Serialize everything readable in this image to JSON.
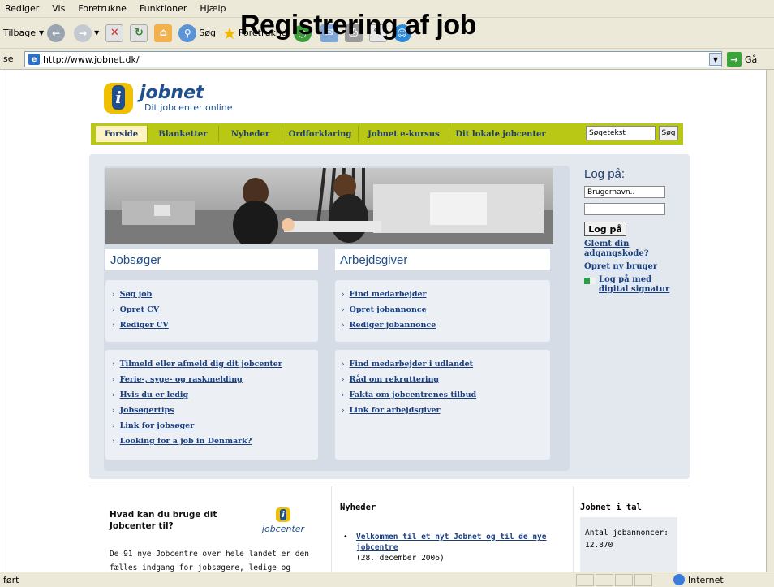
{
  "overlay_title": "Registrering af job",
  "browser": {
    "menu": [
      "Rediger",
      "Vis",
      "Foretrukne",
      "Funktioner",
      "Hjælp"
    ],
    "toolbar": {
      "back": "Tilbage",
      "search": "Søg",
      "favorites": "Foretrukne"
    },
    "address_label": "se",
    "url": "http://www.jobnet.dk/",
    "go": "Gå",
    "status": "ført",
    "zone": "Internet"
  },
  "site": {
    "logo_name": "jobnet",
    "logo_tagline": "Dit jobcenter online",
    "nav": [
      "Forside",
      "Blanketter",
      "Nyheder",
      "Ordforklaring",
      "Jobnet e-kursus",
      "Dit lokale jobcenter"
    ],
    "search_placeholder": "Søgetekst",
    "search_button": "Søg",
    "login": {
      "title": "Log på:",
      "username_placeholder": "Brugernavn..",
      "button": "Log på",
      "forgot": "Glemt din adgangskode?",
      "create": "Opret ny bruger",
      "digital": "Log på med digital signatur"
    },
    "jobseeker": {
      "title": "Jobsøger",
      "links_top": [
        "Søg job",
        "Opret CV",
        "Rediger CV"
      ],
      "links_bottom": [
        "Tilmeld eller afmeld dig dit jobcenter",
        "Ferie-, syge- og raskmelding",
        "Hvis du er ledig",
        "Jobsøgertips",
        "Link for jobsøger",
        "Looking for a job in Denmark?"
      ]
    },
    "employer": {
      "title": "Arbejdsgiver",
      "links_top": [
        "Find medarbejder",
        "Opret jobannonce",
        "Rediger jobannonce"
      ],
      "links_bottom": [
        "Find medarbejder i udlandet",
        "Råd om rekruttering",
        "Fakta om jobcentrenes tilbud",
        "Link for arbejdsgiver"
      ]
    },
    "bottom": {
      "col1_title": "Hvad kan du bruge dit Jobcenter til?",
      "col1_text": "De 91 nye Jobcentre over hele landet er den fælles indgang for jobsøgere, ledige og",
      "jobcenter_logo": "jobcenter",
      "news_title": "Nyheder",
      "news_link": "Velkommen til et nyt Jobnet og til de nye jobcentre",
      "news_date": "(28. december 2006)",
      "stats_title": "Jobnet i tal",
      "stats_label": "Antal jobannoncer:",
      "stats_value": "12.870"
    }
  }
}
